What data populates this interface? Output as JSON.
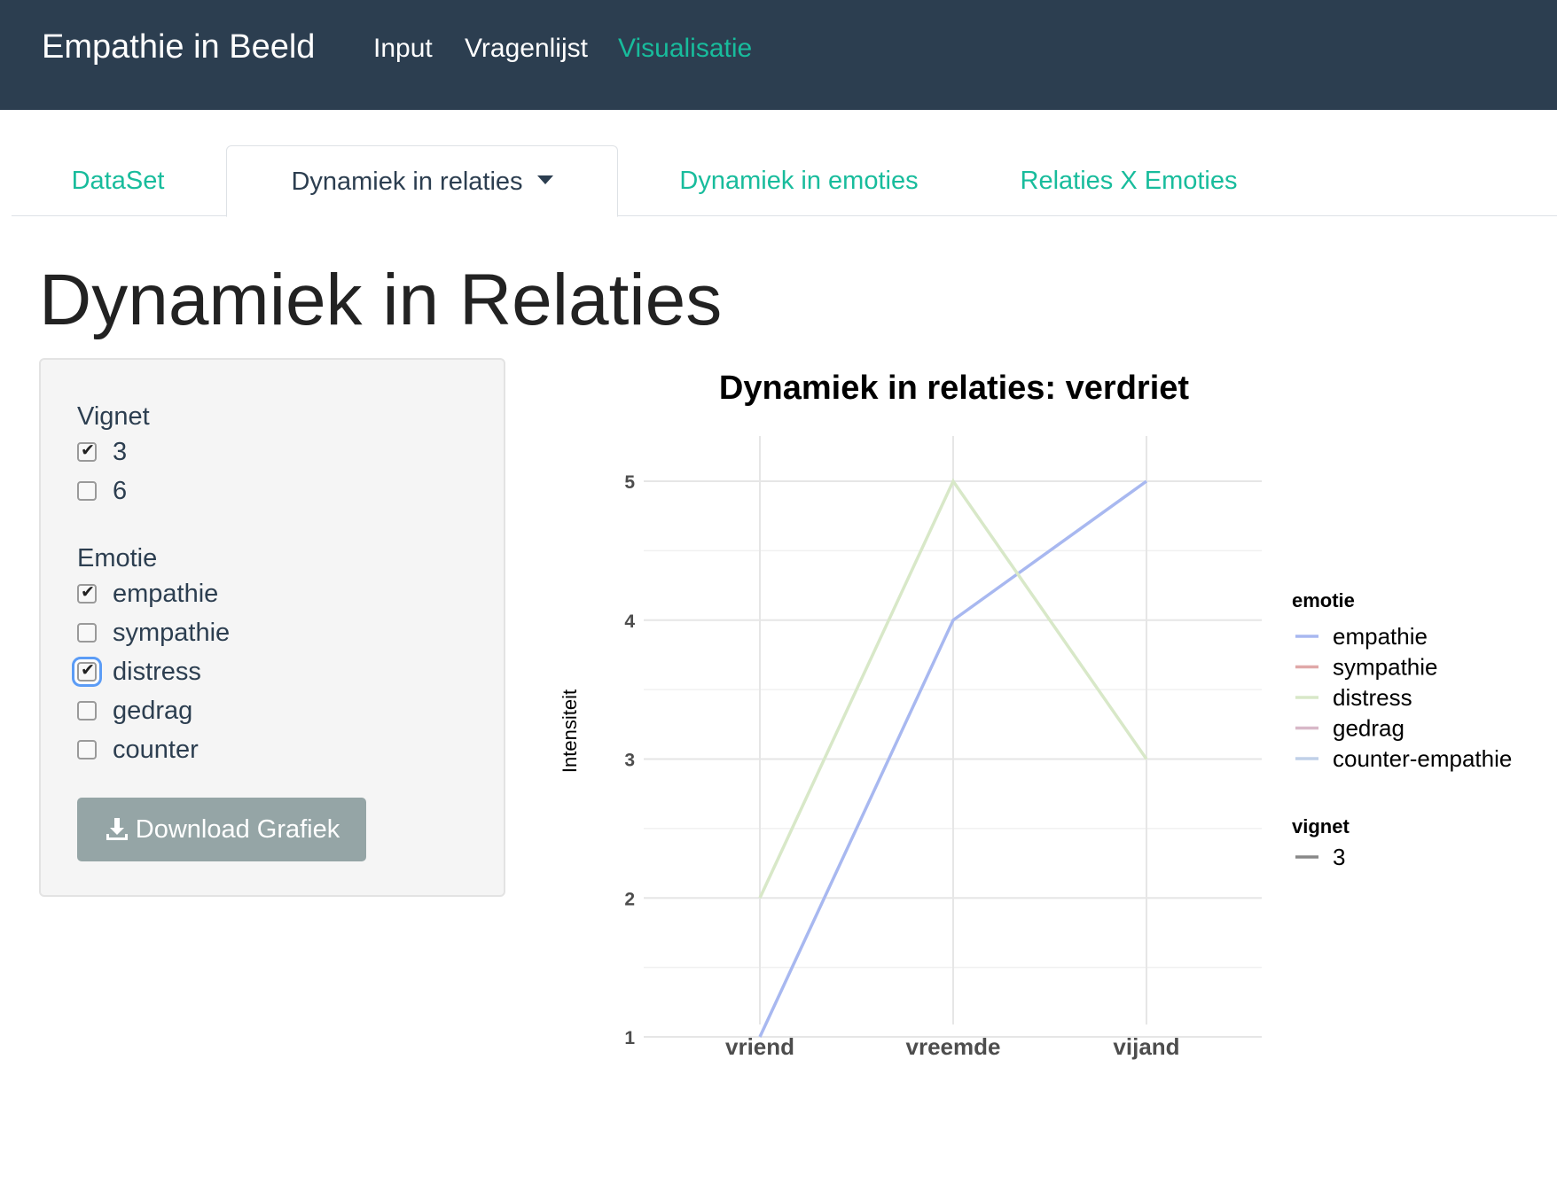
{
  "navbar": {
    "brand": "Empathie in Beeld",
    "links": [
      {
        "label": "Input",
        "active": false
      },
      {
        "label": "Vragenlijst",
        "active": false
      },
      {
        "label": "Visualisatie",
        "active": true
      }
    ]
  },
  "tabs": [
    {
      "label": "DataSet",
      "active": false
    },
    {
      "label": "Dynamiek in relaties",
      "active": true,
      "dropdown": true
    },
    {
      "label": "Dynamiek in emoties",
      "active": false
    },
    {
      "label": "Relaties X Emoties",
      "active": false
    }
  ],
  "page_title": "Dynamiek in Relaties",
  "sidebar": {
    "vignet_label": "Vignet",
    "vignet_options": [
      {
        "label": "3",
        "checked": true
      },
      {
        "label": "6",
        "checked": false
      }
    ],
    "emotie_label": "Emotie",
    "emotie_options": [
      {
        "label": "empathie",
        "checked": true
      },
      {
        "label": "sympathie",
        "checked": false
      },
      {
        "label": "distress",
        "checked": true,
        "focused": true
      },
      {
        "label": "gedrag",
        "checked": false
      },
      {
        "label": "counter",
        "checked": false
      }
    ],
    "download_label": "Download Grafiek",
    "download_icon": "download-icon"
  },
  "colors": {
    "navbar": "#2c3e50",
    "accent": "#18bc9c",
    "button": "#95a5a6"
  },
  "chart_data": {
    "type": "line",
    "title": "Dynamiek in relaties: verdriet",
    "xlabel": "",
    "ylabel": "Intensiteit",
    "categories": [
      "vriend",
      "vreemde",
      "vijand"
    ],
    "yticks": [
      1,
      2,
      3,
      4,
      5
    ],
    "ylim": [
      1,
      5
    ],
    "grid": true,
    "series": [
      {
        "name": "empathie",
        "color": "#a8b8f0",
        "values": [
          1,
          4,
          5
        ]
      },
      {
        "name": "distress",
        "color": "#d8e8c8",
        "values": [
          2,
          5,
          3
        ]
      }
    ],
    "legend": {
      "position": "right",
      "emotie_title": "emotie",
      "emotie_items": [
        {
          "label": "empathie",
          "color": "#a8b8f0"
        },
        {
          "label": "sympathie",
          "color": "#e0a8a8"
        },
        {
          "label": "distress",
          "color": "#d8e8c8"
        },
        {
          "label": "gedrag",
          "color": "#d8b8c8"
        },
        {
          "label": "counter-empathie",
          "color": "#c0d0e8"
        }
      ],
      "vignet_title": "vignet",
      "vignet_items": [
        {
          "label": "3",
          "color": "#888888"
        }
      ]
    }
  }
}
